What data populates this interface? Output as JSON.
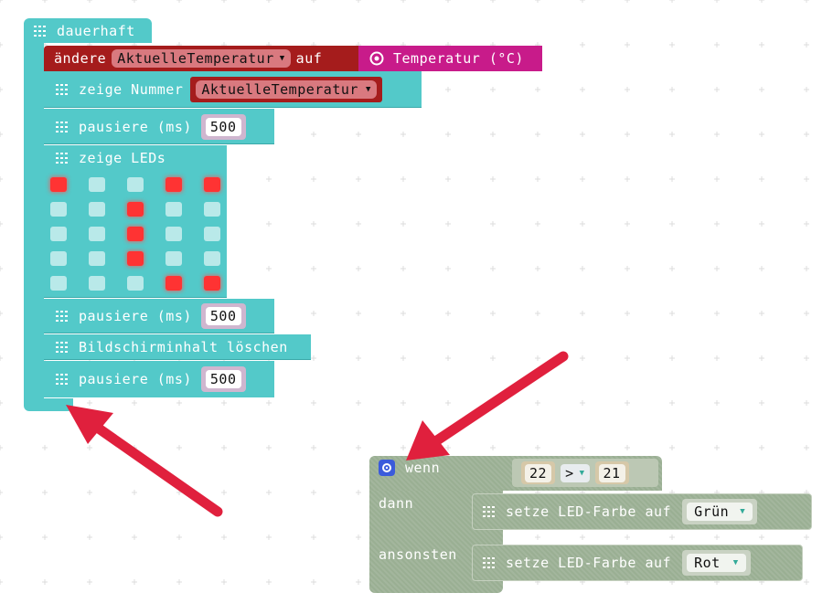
{
  "forever_block": {
    "label": "dauerhaft"
  },
  "set_block": {
    "prefix": "ändere",
    "variable": "AktuelleTemperatur",
    "middle": "auf",
    "value": "Temperatur (°C)"
  },
  "show_number_block": {
    "label": "zeige Nummer",
    "variable": "AktuelleTemperatur"
  },
  "pause_1": {
    "label": "pausiere (ms)",
    "value": "500"
  },
  "show_leds_block": {
    "label": "zeige LEDs",
    "grid": [
      [
        1,
        0,
        0,
        1,
        1
      ],
      [
        0,
        0,
        1,
        0,
        0
      ],
      [
        0,
        0,
        1,
        0,
        0
      ],
      [
        0,
        0,
        1,
        0,
        0
      ],
      [
        0,
        0,
        0,
        1,
        1
      ]
    ]
  },
  "pause_2": {
    "label": "pausiere (ms)",
    "value": "500"
  },
  "clear_block": {
    "label": "Bildschirminhalt löschen"
  },
  "pause_3": {
    "label": "pausiere (ms)",
    "value": "500"
  },
  "if_block": {
    "if_label": "wenn",
    "left": "22",
    "operator": ">",
    "right": "21",
    "then_label": "dann",
    "else_label": "ansonsten",
    "then_action": {
      "label": "setze LED-Farbe auf",
      "value": "Grün"
    },
    "else_action": {
      "label": "setze LED-Farbe auf",
      "value": "Rot"
    }
  },
  "colors": {
    "basic": "#53c9c9",
    "variable": "#a51c1c",
    "input": "#c81b8a",
    "disabled": "#9aaf93",
    "arrow": "#e0203d"
  }
}
